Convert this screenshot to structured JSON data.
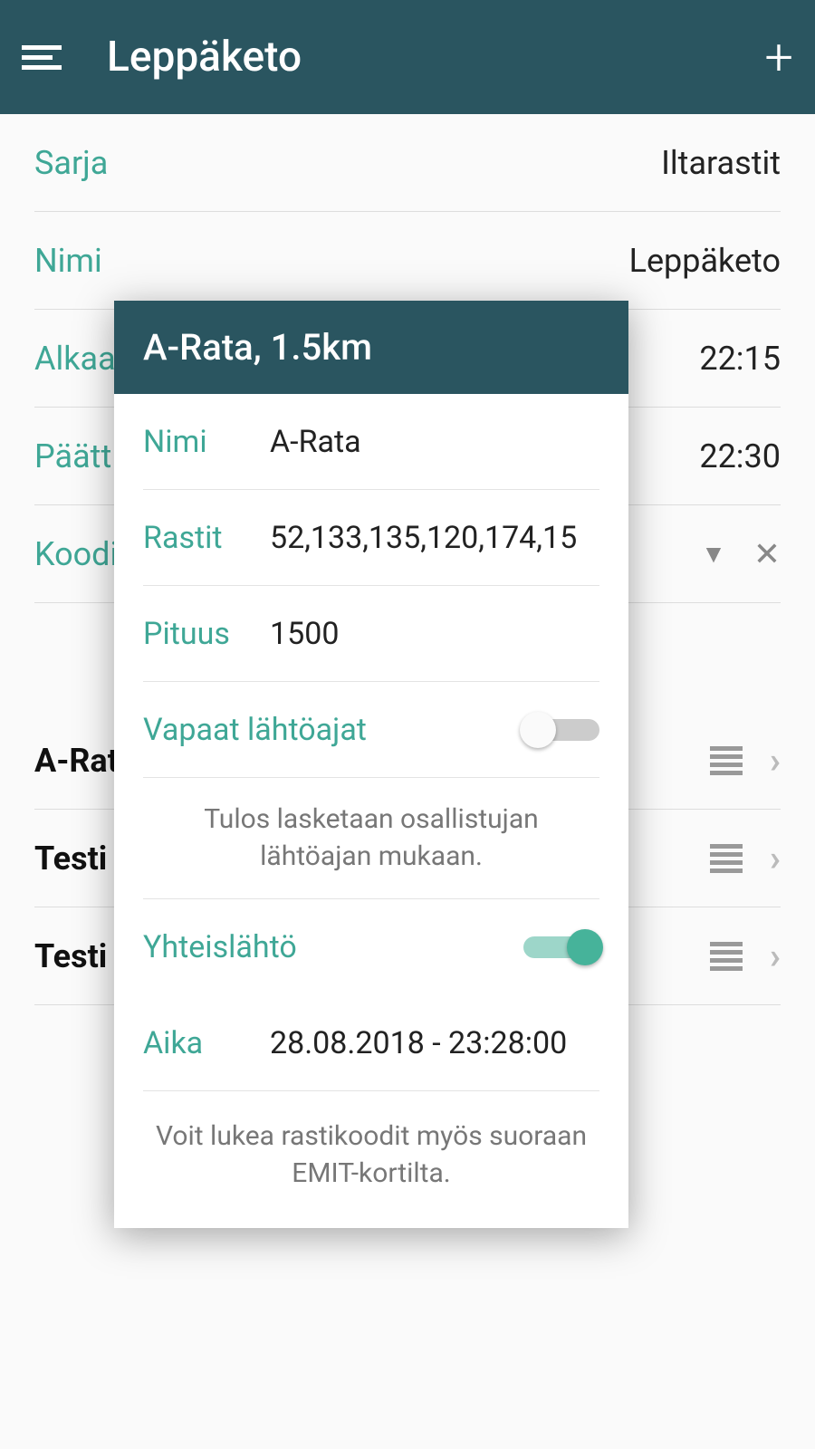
{
  "header": {
    "title": "Leppäketo"
  },
  "bg": {
    "rows": [
      {
        "label": "Sarja",
        "value": "Iltarastit"
      },
      {
        "label": "Nimi",
        "value": "Leppäketo"
      },
      {
        "label": "Alkaa",
        "value": "22:15"
      },
      {
        "label": "Päätt",
        "value": "22:30"
      },
      {
        "label": "Koodi",
        "value": ""
      }
    ],
    "tracks": [
      {
        "name": "A-Rat"
      },
      {
        "name": "Testi"
      },
      {
        "name": "Testi"
      }
    ]
  },
  "dialog": {
    "title": "A-Rata, 1.5km",
    "nimi_label": "Nimi",
    "nimi_value": "A-Rata",
    "rastit_label": "Rastit",
    "rastit_value": "52,133,135,120,174,15",
    "pituus_label": "Pituus",
    "pituus_value": "1500",
    "vapaat_label": "Vapaat lähtöajat",
    "vapaat_on": false,
    "note1": "Tulos lasketaan osallistujan lähtöajan mukaan.",
    "yhteis_label": "Yhteislähtö",
    "yhteis_on": true,
    "aika_label": "Aika",
    "aika_value": "28.08.2018 - 23:28:00",
    "footer": "Voit lukea rastikoodit myös suoraan EMIT-kortilta."
  }
}
